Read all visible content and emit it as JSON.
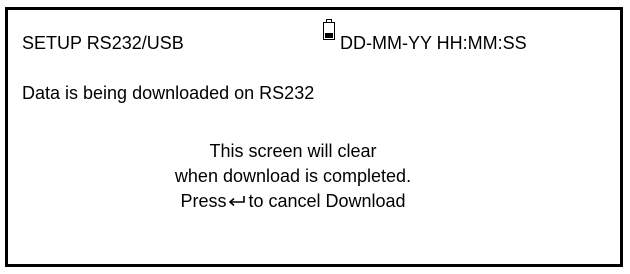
{
  "header": {
    "title": "SETUP RS232/USB",
    "datetime": "DD-MM-YY  HH:MM:SS",
    "battery_icon": "battery-icon"
  },
  "status": {
    "message": "Data is being downloaded on RS232"
  },
  "notice": {
    "line1": "This screen will clear",
    "line2": "when download is completed.",
    "line3_prefix": "Press",
    "line3_icon": "enter-key-icon",
    "line3_suffix": "to cancel Download"
  },
  "colors": {
    "background": "#ffffff",
    "foreground": "#000000"
  }
}
